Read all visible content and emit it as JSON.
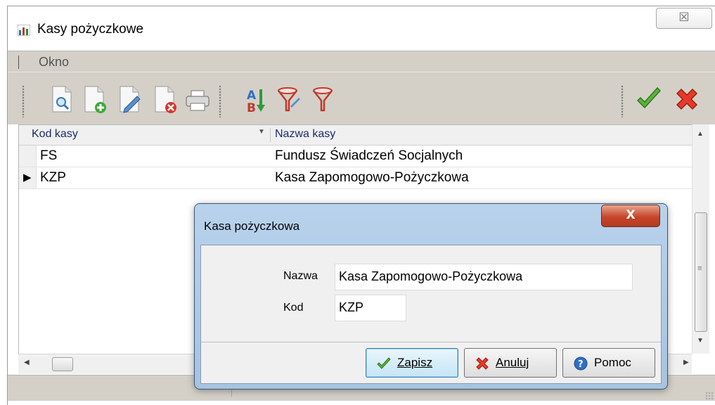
{
  "window": {
    "title": "Kasy pożyczkowe",
    "close_glyph": "☒",
    "app_icon": "chart-app-icon"
  },
  "menu": {
    "items": [
      "Okno"
    ]
  },
  "toolbar": {
    "buttons": [
      "view-record-icon",
      "add-record-icon",
      "edit-record-icon",
      "delete-record-icon",
      "print-icon",
      "sort-az-icon",
      "filter-icon",
      "clear-filter-icon"
    ],
    "confirm": "green-check-icon",
    "cancel": "red-x-icon"
  },
  "grid": {
    "columns": [
      "Kod kasy",
      "Nazwa kasy"
    ],
    "rows": [
      {
        "kod": "FS",
        "nazwa": "Fundusz Świadczeń Socjalnych",
        "current": false
      },
      {
        "kod": "KZP",
        "nazwa": "Kasa Zapomogowo-Pożyczkowa",
        "current": true
      }
    ],
    "current_marker": "▶"
  },
  "dialog": {
    "title": "Kasa pożyczkowa",
    "close_glyph": "X",
    "fields": {
      "nazwa_label": "Nazwa",
      "nazwa_value": "Kasa Zapomogowo-Pożyczkowa",
      "kod_label": "Kod",
      "kod_value": "KZP"
    },
    "buttons": {
      "save": "Zapisz",
      "cancel": "Anuluj",
      "help": "Pomoc"
    }
  },
  "colors": {
    "chrome": "#d4d0c8",
    "header_text": "#1d2a6b",
    "dialog_frame": "#a7c3e0",
    "close_red": "#c7462a"
  }
}
